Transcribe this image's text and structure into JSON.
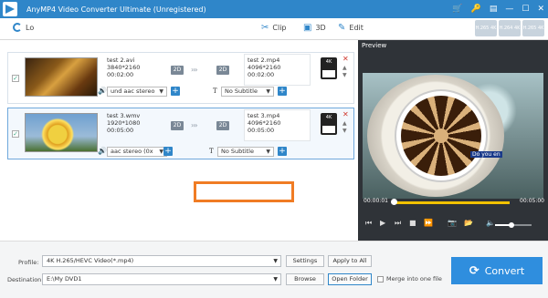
{
  "window": {
    "title": "AnyMP4 Video Converter Ultimate (Unregistered)",
    "controls": [
      "🛒",
      "🔑",
      "▤",
      "—",
      "☐",
      "✕"
    ]
  },
  "toolbar": {
    "load_label": "Lo",
    "clip_label": "Clip",
    "threed_label": "3D",
    "edit_label": "Edit",
    "format_icons": [
      "H.265 4K",
      "H.264 4K",
      "H.265 4K"
    ]
  },
  "files": [
    {
      "source_name": "test 2.avi",
      "source_resolution": "3840*2160",
      "source_duration": "00:02:00",
      "source_badge": "2D",
      "output_badge": "2D",
      "output_name": "test 2.mp4",
      "output_resolution": "4096*2160",
      "output_duration": "00:02:00",
      "audio": "und aac stereo",
      "subtitle": "No Subtitle",
      "format_badge": "4K"
    },
    {
      "source_name": "test 3.wmv",
      "source_resolution": "1920*1080",
      "source_duration": "00:05:00",
      "source_badge": "2D",
      "output_badge": "2D",
      "output_name": "test 3.mp4",
      "output_resolution": "4096*2160",
      "output_duration": "00:05:00",
      "audio": "aac stereo (0x",
      "subtitle": "No Subtitle",
      "format_badge": "4K"
    }
  ],
  "preview": {
    "title": "Preview",
    "subtitle_text": "Do you en",
    "time_current": "00:00:01",
    "time_total": "00:05:00",
    "progress": 0.01,
    "volume": 0.45
  },
  "bottom": {
    "profile_label": "Profile:",
    "profile_value": "4K H.265/HEVC Video(*.mp4)",
    "settings_label": "Settings",
    "apply_all_label": "Apply to All",
    "destination_label": "Destination:",
    "destination_value": "E:\\My DVD1",
    "browse_label": "Browse",
    "open_folder_label": "Open Folder",
    "merge_label": "Merge into one file",
    "convert_label": "Convert"
  }
}
